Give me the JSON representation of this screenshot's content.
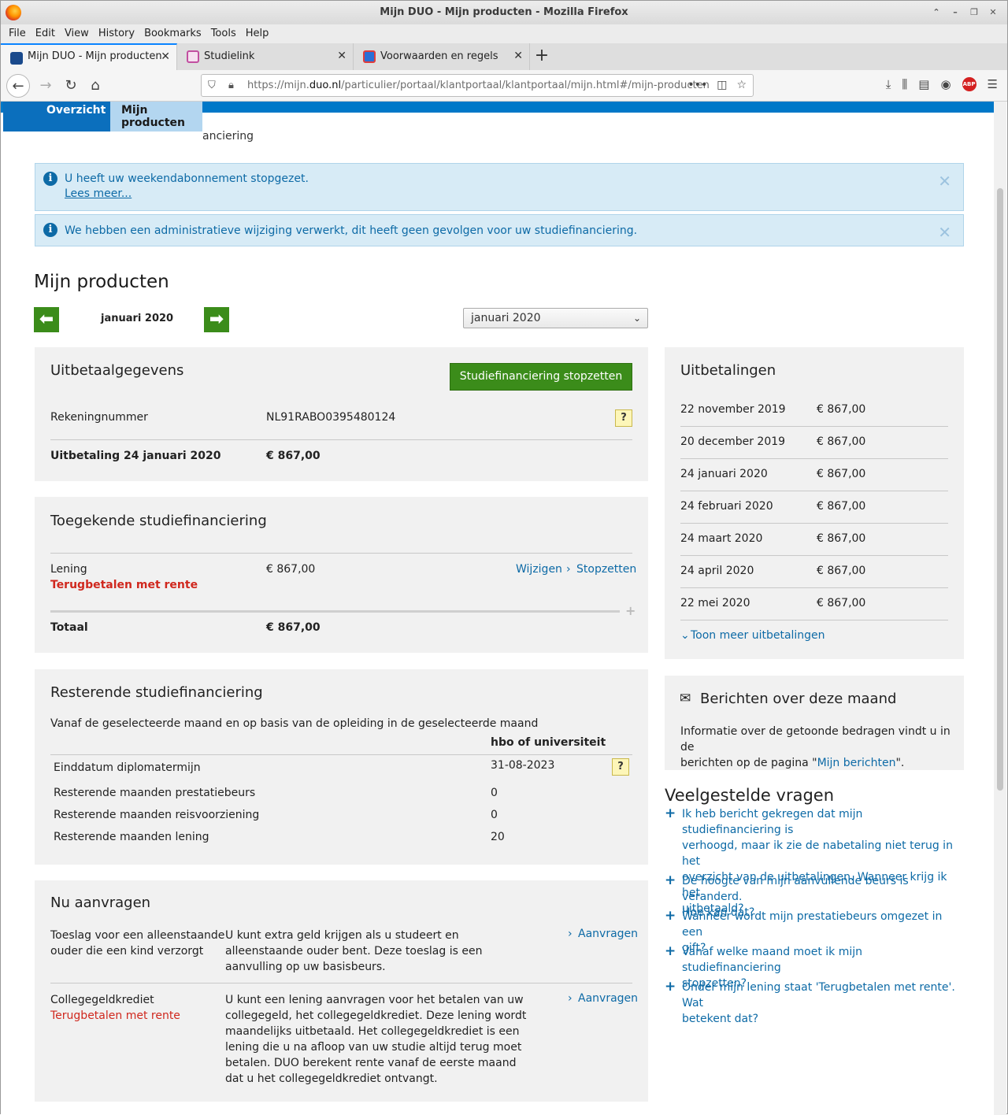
{
  "browser": {
    "window_title": "Mijn DUO - Mijn producten - Mozilla Firefox",
    "menu": [
      "File",
      "Edit",
      "View",
      "History",
      "Bookmarks",
      "Tools",
      "Help"
    ],
    "tabs": [
      {
        "label": "Mijn DUO - Mijn producten",
        "favicon": "#1a4a8c"
      },
      {
        "label": "Studielink",
        "favicon": "#c24fa0"
      },
      {
        "label": "Voorwaarden en regels kwijts",
        "favicon": "#2a6fd6"
      }
    ],
    "url_prefix": "https://mijn.",
    "url_domain": "duo.nl",
    "url_path": "/particulier/portaal/klantportaal/klantportaal/mijn.html#/mijn-producten",
    "url_more": "•••"
  },
  "site": {
    "nav": [
      "Overzicht",
      "Mijn producten"
    ],
    "breadcrumb": "anciering"
  },
  "alerts": [
    {
      "text": "U heeft uw weekendabonnement stopgezet.",
      "link": "Lees meer..."
    },
    {
      "text": "We hebben een administratieve wijziging verwerkt, dit heeft geen gevolgen voor uw studiefinanciering."
    }
  ],
  "page_title": "Mijn producten",
  "month_nav": {
    "current": "januari 2020",
    "select_value": "januari 2020"
  },
  "uitbetaal": {
    "title": "Uitbetaalgegevens",
    "stop_button": "Studiefinanciering stopzetten",
    "rekening_label": "Rekeningnummer",
    "rekening_value": "NL91RABO0395480124",
    "uitbetaling_label": "Uitbetaling 24 januari 2020",
    "uitbetaling_value": "€ 867,00",
    "help": "?"
  },
  "toegekend": {
    "title": "Toegekende studiefinanciering",
    "lening_label": "Lening",
    "lening_sub": "Terugbetalen met rente",
    "lening_value": "€ 867,00",
    "wijzigen": "Wijzigen",
    "stopzetten": "Stopzetten",
    "totaal_label": "Totaal",
    "totaal_value": "€ 867,00"
  },
  "resterend": {
    "title": "Resterende studiefinanciering",
    "intro": "Vanaf de geselecteerde maand en op basis van de opleiding in de geselecteerde maand",
    "col_header": "hbo of universiteit",
    "rows": [
      {
        "label": "Einddatum diplomatermijn",
        "value": "31-08-2023"
      },
      {
        "label": "Resterende maanden prestatiebeurs",
        "value": "0"
      },
      {
        "label": "Resterende maanden reisvoorziening",
        "value": "0"
      },
      {
        "label": "Resterende maanden lening",
        "value": "20"
      }
    ]
  },
  "aanvragen": {
    "title": "Nu aanvragen",
    "items": [
      {
        "name_l1": "Toeslag voor een alleenstaande",
        "name_l2": "ouder die een kind verzorgt",
        "sub": "",
        "desc": [
          "U kunt extra geld krijgen als u studeert en",
          "alleenstaande ouder bent. Deze toeslag is een",
          "aanvulling op uw basisbeurs."
        ],
        "action": "Aanvragen"
      },
      {
        "name_l1": "Collegegeldkrediet",
        "name_l2": "",
        "sub": "Terugbetalen met rente",
        "desc": [
          "U kunt een lening aanvragen voor het betalen van uw",
          "collegegeld, het collegegeldkrediet. Deze lening wordt",
          "maandelijks uitbetaald. Het collegegeldkrediet is een",
          "lening die u na afloop van uw studie altijd terug moet",
          "betalen. DUO berekent rente vanaf de eerste maand",
          "dat u het collegegeldkrediet ontvangt."
        ],
        "action": "Aanvragen"
      }
    ]
  },
  "uitbetalingen": {
    "title": "Uitbetalingen",
    "rows": [
      {
        "date": "22 november 2019",
        "amount": "€ 867,00"
      },
      {
        "date": "20 december 2019",
        "amount": "€ 867,00"
      },
      {
        "date": "24 januari 2020",
        "amount": "€ 867,00"
      },
      {
        "date": "24 februari 2020",
        "amount": "€ 867,00"
      },
      {
        "date": "24 maart 2020",
        "amount": "€ 867,00"
      },
      {
        "date": "24 april 2020",
        "amount": "€ 867,00"
      },
      {
        "date": "22 mei 2020",
        "amount": "€ 867,00"
      }
    ],
    "more": "Toon meer uitbetalingen"
  },
  "berichten": {
    "title": "Berichten over deze maand",
    "text_l1": "Informatie over de getoonde bedragen vindt u in de",
    "text_l2_pre": "berichten op de pagina \"",
    "link": "Mijn berichten",
    "text_l2_post": "\"."
  },
  "faq": {
    "title": "Veelgestelde vragen",
    "items": [
      [
        "Ik heb bericht gekregen dat mijn studiefinanciering is",
        "verhoogd, maar ik zie de nabetaling niet terug in het",
        "overzicht van de uitbetalingen. Wanneer krijg ik het",
        "uitbetaald?"
      ],
      [
        "De hoogte van mijn aanvullende beurs is veranderd.",
        "Hoe kan dat?"
      ],
      [
        "Wanneer wordt mijn prestatiebeurs omgezet in een",
        "gift?"
      ],
      [
        "Vanaf welke maand moet ik mijn studiefinanciering",
        "stopzetten?"
      ],
      [
        "Onder mijn lening staat 'Terugbetalen met rente'. Wat",
        "betekent dat?"
      ]
    ]
  },
  "colors": {
    "accent": "#0078c8",
    "green": "#3b8c1a",
    "link": "#0d6aa6",
    "red": "#d0281e"
  }
}
